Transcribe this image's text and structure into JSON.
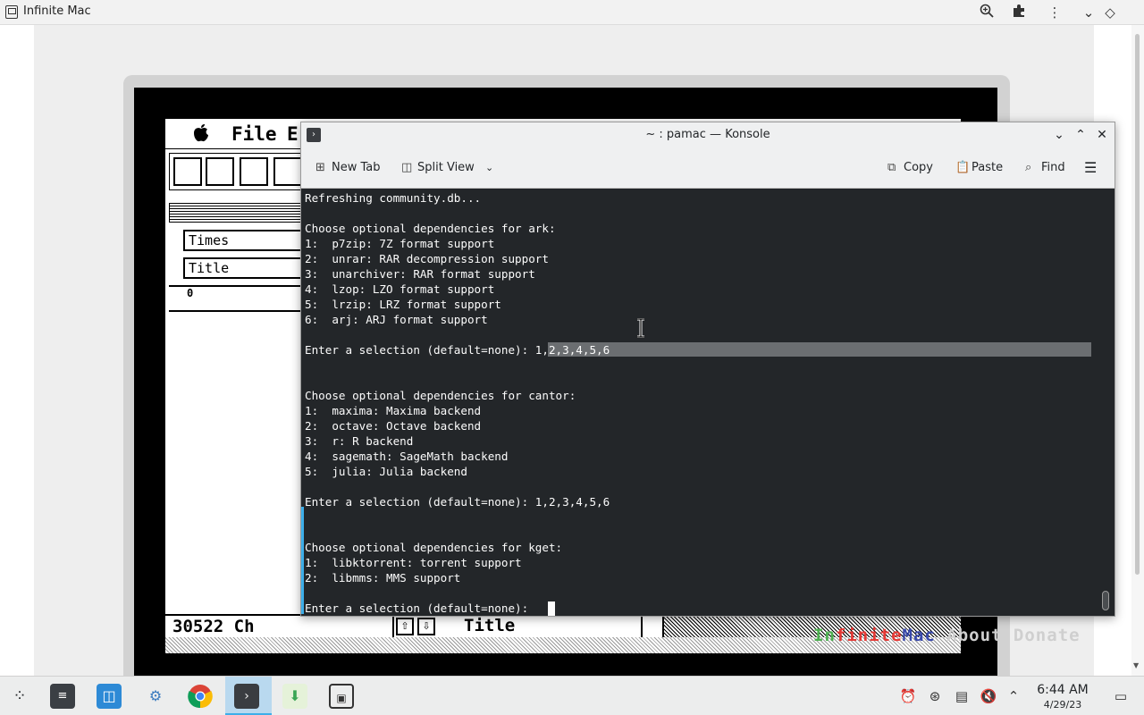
{
  "browser": {
    "title": "Infinite Mac",
    "toolbar_icons": [
      "zoom-icon",
      "extensions-icon",
      "menu-kebab-icon",
      "minimize-icon",
      "restore-icon"
    ]
  },
  "mac": {
    "menu": {
      "file": "File",
      "edit": "E"
    },
    "font_field": "Times",
    "style_field": "Title",
    "ruler_zero": "0",
    "char_count": "30522 Ch",
    "status_style": "Title",
    "footer_links": {
      "l1": "In",
      "l2": "finite",
      "l3": "Mac",
      "l4": " About Donate"
    }
  },
  "konsole": {
    "title": "~ : pamac — Konsole",
    "toolbar": {
      "new_tab": "New Tab",
      "split_view": "Split View",
      "copy": "Copy",
      "paste": "Paste",
      "find": "Find"
    },
    "lines": [
      "Refreshing community.db...",
      "",
      "Choose optional dependencies for ark:",
      "1:  p7zip: 7Z format support",
      "2:  unrar: RAR decompression support",
      "3:  unarchiver: RAR format support",
      "4:  lzop: LZO format support",
      "5:  lrzip: LRZ format support",
      "6:  arj: ARJ format support",
      "",
      "Enter a selection (default=none): 1,2,3,4,5,6",
      "",
      "",
      "Choose optional dependencies for cantor:",
      "1:  maxima: Maxima backend",
      "2:  octave: Octave backend",
      "3:  r: R backend",
      "4:  sagemath: SageMath backend",
      "5:  julia: Julia backend",
      "",
      "Enter a selection (default=none): 1,2,3,4,5,6",
      "",
      "",
      "Choose optional dependencies for kget:",
      "1:  libktorrent: torrent support",
      "2:  libmms: MMS support",
      "",
      "Enter a selection (default=none): "
    ]
  },
  "taskbar": {
    "clock_time": "6:44 AM",
    "clock_date": "4/29/23"
  }
}
